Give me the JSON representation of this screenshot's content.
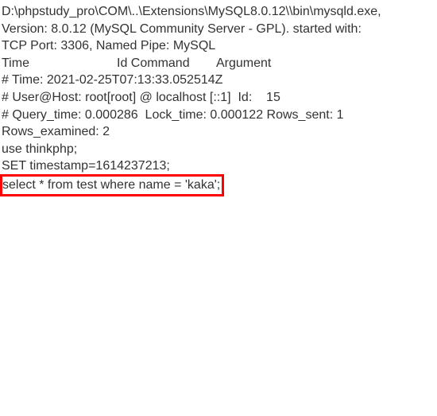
{
  "log": {
    "line1": "D:\\phpstudy_pro\\COM\\..\\Extensions\\MySQL8.0.12\\\\bin\\mysqld.exe,",
    "line2": "Version: 8.0.12 (MySQL Community Server - GPL). started with:",
    "line3": "TCP Port: 3306, Named Pipe: MySQL",
    "header": {
      "col1": "Time",
      "col2": "Id Command",
      "col3": "Argument"
    },
    "line5": "# Time: 2021-02-25T07:13:33.052514Z",
    "line6": "# User@Host: root[root] @ localhost [::1]  Id:    15",
    "line7": "# Query_time: 0.000286  Lock_time: 0.000122 Rows_sent: 1",
    "line8": "Rows_examined: 2",
    "line9": "use thinkphp;",
    "line10": "SET timestamp=1614237213;",
    "query": "select * from test where name = 'kaka';"
  }
}
